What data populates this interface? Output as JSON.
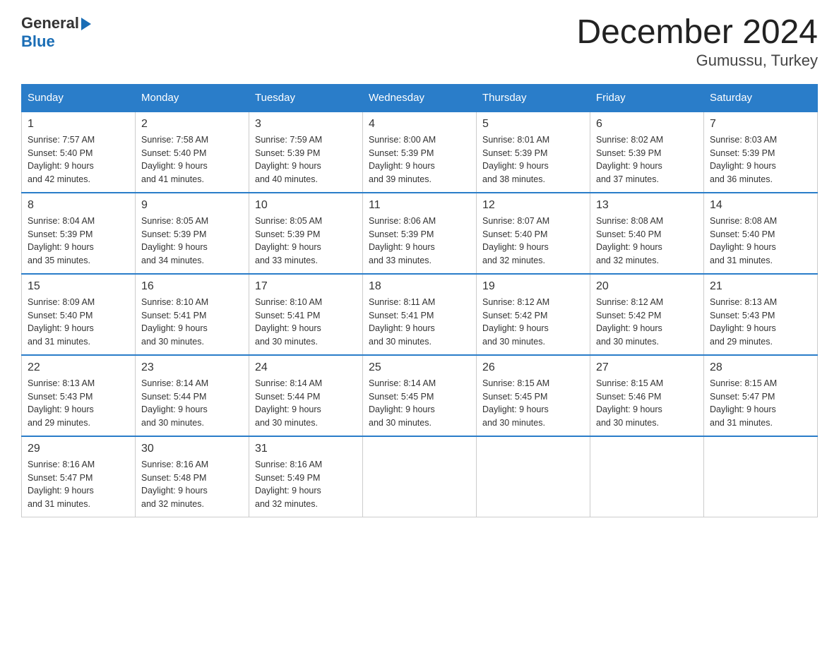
{
  "header": {
    "logo_general": "General",
    "logo_blue": "Blue",
    "title": "December 2024",
    "subtitle": "Gumussu, Turkey"
  },
  "days_of_week": [
    "Sunday",
    "Monday",
    "Tuesday",
    "Wednesday",
    "Thursday",
    "Friday",
    "Saturday"
  ],
  "weeks": [
    [
      {
        "day": "1",
        "sunrise": "7:57 AM",
        "sunset": "5:40 PM",
        "daylight": "9 hours and 42 minutes."
      },
      {
        "day": "2",
        "sunrise": "7:58 AM",
        "sunset": "5:40 PM",
        "daylight": "9 hours and 41 minutes."
      },
      {
        "day": "3",
        "sunrise": "7:59 AM",
        "sunset": "5:39 PM",
        "daylight": "9 hours and 40 minutes."
      },
      {
        "day": "4",
        "sunrise": "8:00 AM",
        "sunset": "5:39 PM",
        "daylight": "9 hours and 39 minutes."
      },
      {
        "day": "5",
        "sunrise": "8:01 AM",
        "sunset": "5:39 PM",
        "daylight": "9 hours and 38 minutes."
      },
      {
        "day": "6",
        "sunrise": "8:02 AM",
        "sunset": "5:39 PM",
        "daylight": "9 hours and 37 minutes."
      },
      {
        "day": "7",
        "sunrise": "8:03 AM",
        "sunset": "5:39 PM",
        "daylight": "9 hours and 36 minutes."
      }
    ],
    [
      {
        "day": "8",
        "sunrise": "8:04 AM",
        "sunset": "5:39 PM",
        "daylight": "9 hours and 35 minutes."
      },
      {
        "day": "9",
        "sunrise": "8:05 AM",
        "sunset": "5:39 PM",
        "daylight": "9 hours and 34 minutes."
      },
      {
        "day": "10",
        "sunrise": "8:05 AM",
        "sunset": "5:39 PM",
        "daylight": "9 hours and 33 minutes."
      },
      {
        "day": "11",
        "sunrise": "8:06 AM",
        "sunset": "5:39 PM",
        "daylight": "9 hours and 33 minutes."
      },
      {
        "day": "12",
        "sunrise": "8:07 AM",
        "sunset": "5:40 PM",
        "daylight": "9 hours and 32 minutes."
      },
      {
        "day": "13",
        "sunrise": "8:08 AM",
        "sunset": "5:40 PM",
        "daylight": "9 hours and 32 minutes."
      },
      {
        "day": "14",
        "sunrise": "8:08 AM",
        "sunset": "5:40 PM",
        "daylight": "9 hours and 31 minutes."
      }
    ],
    [
      {
        "day": "15",
        "sunrise": "8:09 AM",
        "sunset": "5:40 PM",
        "daylight": "9 hours and 31 minutes."
      },
      {
        "day": "16",
        "sunrise": "8:10 AM",
        "sunset": "5:41 PM",
        "daylight": "9 hours and 30 minutes."
      },
      {
        "day": "17",
        "sunrise": "8:10 AM",
        "sunset": "5:41 PM",
        "daylight": "9 hours and 30 minutes."
      },
      {
        "day": "18",
        "sunrise": "8:11 AM",
        "sunset": "5:41 PM",
        "daylight": "9 hours and 30 minutes."
      },
      {
        "day": "19",
        "sunrise": "8:12 AM",
        "sunset": "5:42 PM",
        "daylight": "9 hours and 30 minutes."
      },
      {
        "day": "20",
        "sunrise": "8:12 AM",
        "sunset": "5:42 PM",
        "daylight": "9 hours and 30 minutes."
      },
      {
        "day": "21",
        "sunrise": "8:13 AM",
        "sunset": "5:43 PM",
        "daylight": "9 hours and 29 minutes."
      }
    ],
    [
      {
        "day": "22",
        "sunrise": "8:13 AM",
        "sunset": "5:43 PM",
        "daylight": "9 hours and 29 minutes."
      },
      {
        "day": "23",
        "sunrise": "8:14 AM",
        "sunset": "5:44 PM",
        "daylight": "9 hours and 30 minutes."
      },
      {
        "day": "24",
        "sunrise": "8:14 AM",
        "sunset": "5:44 PM",
        "daylight": "9 hours and 30 minutes."
      },
      {
        "day": "25",
        "sunrise": "8:14 AM",
        "sunset": "5:45 PM",
        "daylight": "9 hours and 30 minutes."
      },
      {
        "day": "26",
        "sunrise": "8:15 AM",
        "sunset": "5:45 PM",
        "daylight": "9 hours and 30 minutes."
      },
      {
        "day": "27",
        "sunrise": "8:15 AM",
        "sunset": "5:46 PM",
        "daylight": "9 hours and 30 minutes."
      },
      {
        "day": "28",
        "sunrise": "8:15 AM",
        "sunset": "5:47 PM",
        "daylight": "9 hours and 31 minutes."
      }
    ],
    [
      {
        "day": "29",
        "sunrise": "8:16 AM",
        "sunset": "5:47 PM",
        "daylight": "9 hours and 31 minutes."
      },
      {
        "day": "30",
        "sunrise": "8:16 AM",
        "sunset": "5:48 PM",
        "daylight": "9 hours and 32 minutes."
      },
      {
        "day": "31",
        "sunrise": "8:16 AM",
        "sunset": "5:49 PM",
        "daylight": "9 hours and 32 minutes."
      },
      null,
      null,
      null,
      null
    ]
  ],
  "labels": {
    "sunrise": "Sunrise:",
    "sunset": "Sunset:",
    "daylight": "Daylight:"
  }
}
